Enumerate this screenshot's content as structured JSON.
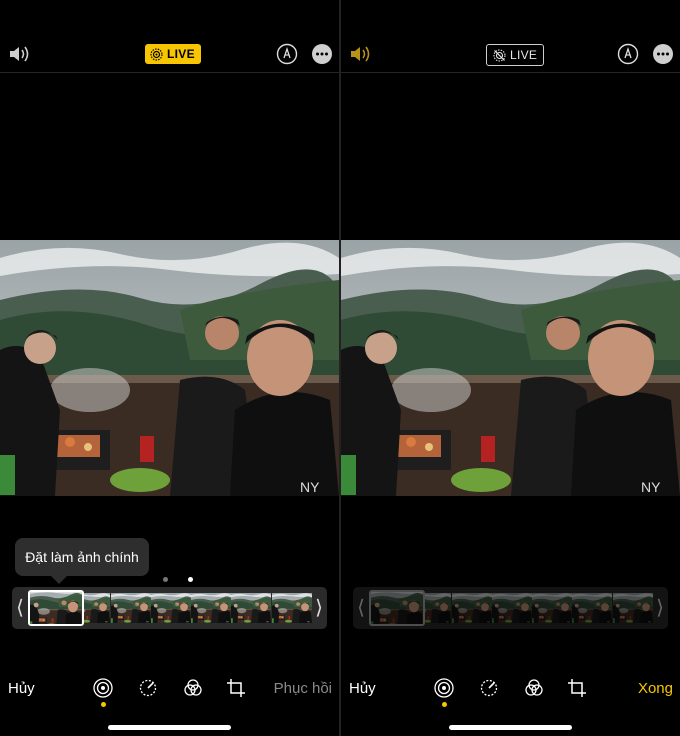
{
  "left": {
    "live_label": "LIVE",
    "tooltip": "Đặt làm ảnh chính",
    "cancel": "Hủy",
    "revert": "Phục hồi"
  },
  "right": {
    "live_label": "LIVE",
    "cancel": "Hủy",
    "done": "Xong"
  },
  "icons": {
    "sound": "speaker-icon",
    "live": "live-photo-icon",
    "markup": "markup-pen-icon",
    "more": "more-icon",
    "tools": [
      "live-tool-icon",
      "adjust-icon",
      "filters-icon",
      "crop-icon"
    ]
  },
  "colors": {
    "accent": "#f7c600",
    "background": "#000000",
    "muted_text": "#8a8a8a"
  },
  "filmstrip": {
    "frame_count": 9,
    "active_dot": 2,
    "dot_count": 2
  }
}
